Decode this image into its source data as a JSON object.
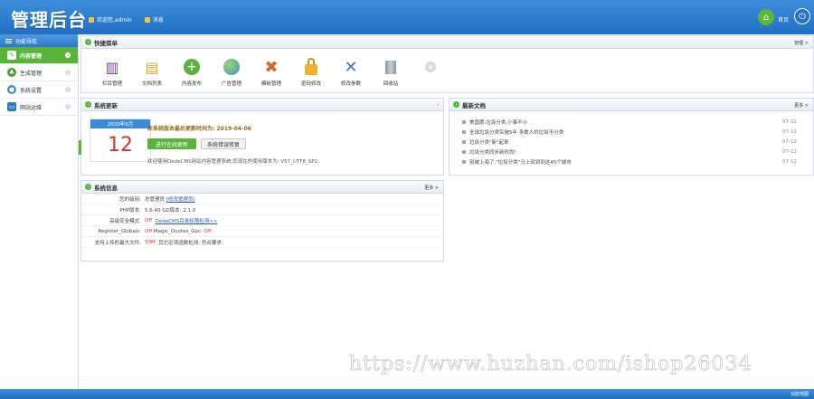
{
  "header": {
    "logo": "管理后台",
    "welcome": "欢迎您,admin",
    "message": "消息",
    "home_label": "首页"
  },
  "sidebar": {
    "title": "功能导航",
    "items": [
      {
        "label": "内容管理",
        "active": true,
        "icon": "edit-icon",
        "color": "#ffffff"
      },
      {
        "label": "生成管理",
        "active": false,
        "icon": "tree-icon",
        "color": "#4a9d2b"
      },
      {
        "label": "系统设置",
        "active": false,
        "icon": "palette-icon",
        "color": "#3d8ad8"
      },
      {
        "label": "网站运维",
        "active": false,
        "icon": "monitor-icon",
        "color": "#2d79c8"
      }
    ]
  },
  "quick": {
    "title": "快捷菜单",
    "manage": "管理 >",
    "items": [
      {
        "label": "栏目管理",
        "icon": "books-icon",
        "glyph": "📚"
      },
      {
        "label": "文档列表",
        "icon": "notebook-icon",
        "glyph": "📒"
      },
      {
        "label": "内容发布",
        "icon": "plus-circle-icon",
        "glyph": "➕"
      },
      {
        "label": "广告管理",
        "icon": "globe-icon",
        "glyph": "🌏"
      },
      {
        "label": "模板管理",
        "icon": "tools-cross-icon",
        "glyph": "✖"
      },
      {
        "label": "密码修改",
        "icon": "lock-icon",
        "glyph": "🔒"
      },
      {
        "label": "修改参数",
        "icon": "wrench-icon",
        "glyph": "🔧"
      },
      {
        "label": "回收站",
        "icon": "trash-icon",
        "glyph": "🗑"
      }
    ]
  },
  "sysupdate": {
    "title": "系统更新",
    "cal_month": "2020年5月",
    "cal_day": "12",
    "version_text": "新系统版本最后更新时间为: ",
    "version_date": "2019-04-06",
    "btn_update": "进行在线更新",
    "btn_repair": "系统错误修复",
    "note": "欢迎使用DedeCMS网站内容管理系统,您现在的使用版本为: V57_UTF8_SP2。"
  },
  "latest": {
    "title": "最新文档",
    "more": "更多 >",
    "items": [
      {
        "title": "美国惠:垃圾分类,小事不小",
        "date": "07-12"
      },
      {
        "title": "全球垃圾分类实施5年 多数人的垃圾不分类",
        "date": "07-12"
      },
      {
        "title": "垃圾分类\"新\"起来",
        "date": "07-12"
      },
      {
        "title": "垃圾分类同步新时尚!",
        "date": "07-12"
      },
      {
        "title": "别被上海了,\"垃圾分类\"马上就到到这45个城市",
        "date": "07-12"
      }
    ]
  },
  "sysinfo": {
    "title": "系统信息",
    "more": "更多 >",
    "rows": [
      {
        "k": "您的级别:",
        "v": "总管理员",
        "link": "[修改管理员]"
      },
      {
        "k": "PHP版本:",
        "v": "5.6.40 GD版本: 2.1.0"
      },
      {
        "k": "高级安全模式:",
        "red": "Off",
        "link": "DedeCMS目录权限检测>>"
      },
      {
        "k": "Register_Globals:",
        "red": "Off",
        "v": "Magic_Quotes_Gpc:",
        "red2": "Off"
      },
      {
        "k": "支持上传的最大文件:",
        "red": "50M",
        "v": "其它必须函数检测: 符合要求"
      }
    ]
  },
  "footer": {
    "text": "功能地图"
  },
  "watermark": "https://www.huzhan.com/ishop26034"
}
